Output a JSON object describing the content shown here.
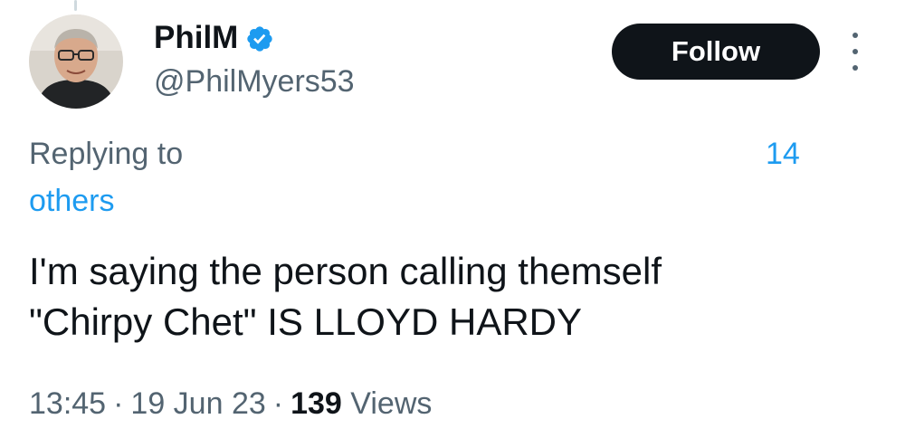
{
  "user": {
    "display_name": "PhilM",
    "handle": "@PhilMyers53",
    "verified": true,
    "verified_color": "#1d9bf0"
  },
  "actions": {
    "follow_label": "Follow",
    "more_icon": "more-vertical-icon"
  },
  "reply_context": {
    "prefix": "Replying to",
    "others_label": "others",
    "count": "14",
    "link_color": "#1d9bf0"
  },
  "tweet": {
    "lines": [
      "I'm saying the person calling themself",
      "\"Chirpy Chet\" IS LLOYD HARDY"
    ]
  },
  "meta": {
    "time": "13:45",
    "date": "19 Jun 23",
    "views_count": "139",
    "views_label": "Views",
    "separator": "·"
  }
}
